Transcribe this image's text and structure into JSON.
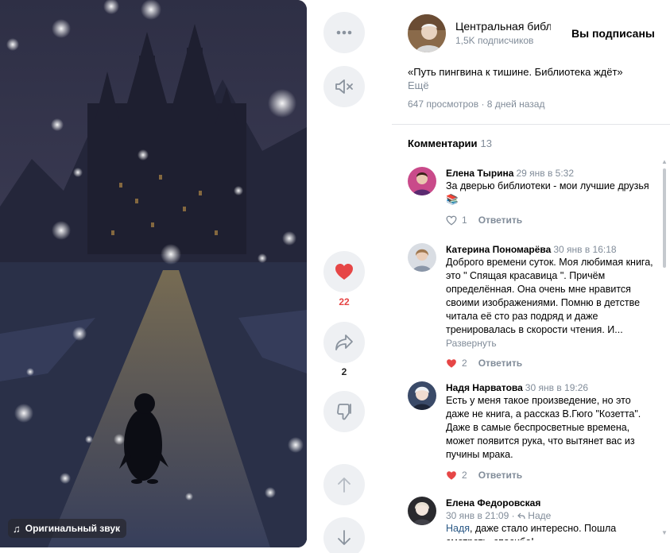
{
  "video": {
    "sound_label": "Оригинальный звук"
  },
  "actions": {
    "like_count": "22",
    "share_count": "2"
  },
  "author": {
    "name": "Центральная библиотека",
    "subscribers": "1,5K подписчиков",
    "subscribe_state": "Вы подписаны"
  },
  "post": {
    "description": "«Путь пингвина к тишине. Библиотека ждёт»",
    "more": "Ещё",
    "views": "647 просмотров",
    "date": "8 дней назад"
  },
  "comments_header": {
    "title": "Комментарии",
    "count": "13"
  },
  "comments": [
    {
      "name": "Елена Тырина",
      "date": "29 янв в 5:32",
      "text": "За дверью библиотеки - мои лучшие друзья 📚",
      "likes": "1",
      "liked": false,
      "reply": "Ответить"
    },
    {
      "name": "Катерина Пономарёва",
      "date": "30 янв в 16:18",
      "text": "Доброго времени суток. Моя любимая книга, это \" Спящая красавица \". Причём определённая. Она очень мне нравится своими изображениями. Помню в детстве читала её сто раз подряд и даже тренировалась в скорости чтения. И...",
      "expand": "Развернуть",
      "likes": "2",
      "liked": true,
      "reply": "Ответить"
    },
    {
      "name": "Надя Нарватова",
      "date": "30 янв в 19:26",
      "text": "Есть у меня такое произведение, но это даже не книга, а рассказ В.Гюго \"Козетта\". Даже в самые беспросветные времена, может появится рука, что вытянет вас из пучины мрака.",
      "likes": "2",
      "liked": true,
      "reply": "Ответить"
    },
    {
      "name": "Елена Федоровская",
      "date": "30 янв в 21:09",
      "reply_to": "Наде",
      "mention": "Надя",
      "text": ", даже стало интересно. Пошла смотреть, спасибо!"
    }
  ],
  "colors": {
    "accent_red": "#e64646",
    "muted": "#818c99",
    "button_bg": "#eef0f3",
    "link": "#2a5885"
  }
}
